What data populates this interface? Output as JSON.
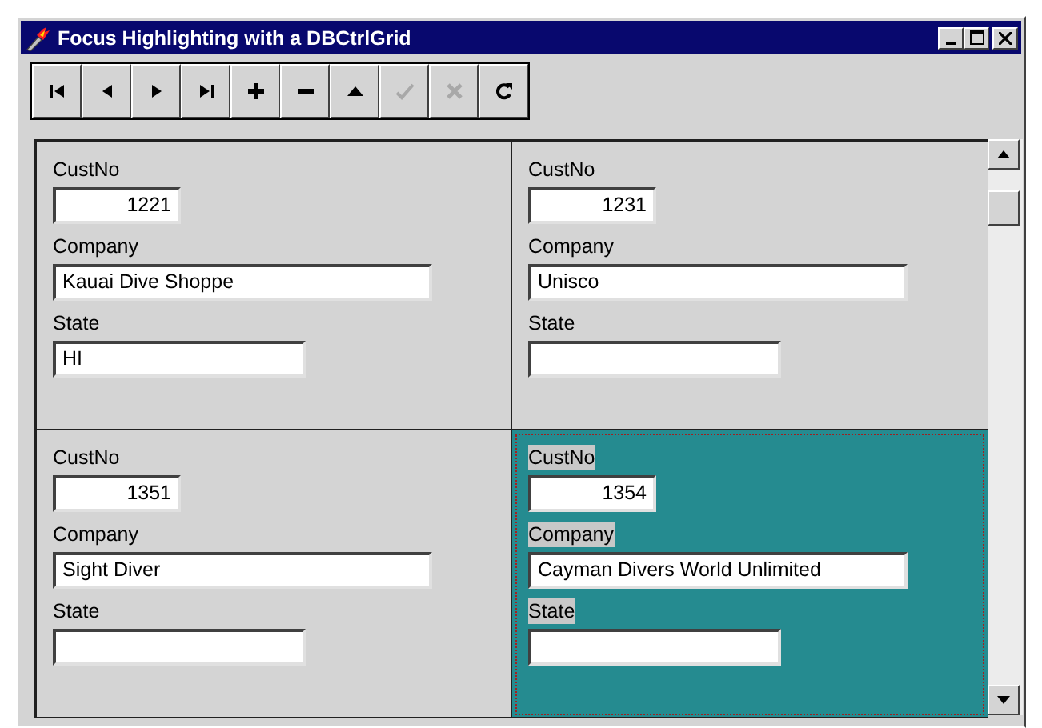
{
  "window": {
    "title": "Focus Highlighting with a DBCtrlGrid"
  },
  "navigator": [
    {
      "kind": "first",
      "disabled": false
    },
    {
      "kind": "prior",
      "disabled": false
    },
    {
      "kind": "next",
      "disabled": false
    },
    {
      "kind": "last",
      "disabled": false
    },
    {
      "kind": "insert",
      "disabled": false
    },
    {
      "kind": "delete",
      "disabled": false
    },
    {
      "kind": "edit",
      "disabled": false
    },
    {
      "kind": "post",
      "disabled": true
    },
    {
      "kind": "cancel",
      "disabled": true
    },
    {
      "kind": "refresh",
      "disabled": false
    }
  ],
  "records": [
    {
      "selected": false,
      "fields": [
        {
          "label": "CustNo",
          "value": "1221",
          "kind": "number"
        },
        {
          "label": "Company",
          "value": "Kauai Dive Shoppe",
          "kind": "wide"
        },
        {
          "label": "State",
          "value": "HI",
          "kind": "text"
        }
      ]
    },
    {
      "selected": false,
      "fields": [
        {
          "label": "CustNo",
          "value": "1231",
          "kind": "number"
        },
        {
          "label": "Company",
          "value": "Unisco",
          "kind": "wide"
        },
        {
          "label": "State",
          "kind": "text"
        }
      ]
    },
    {
      "selected": false,
      "fields": [
        {
          "label": "CustNo",
          "value": "1351",
          "kind": "number"
        },
        {
          "label": "Company",
          "value": "Sight Diver",
          "kind": "wide"
        },
        {
          "label": "State",
          "kind": "text"
        }
      ]
    },
    {
      "selected": true,
      "fields": [
        {
          "label": "CustNo",
          "value": "1354",
          "kind": "number"
        },
        {
          "label": "Company",
          "value": "Cayman Divers World Unlimited",
          "kind": "wide"
        },
        {
          "label": "State",
          "kind": "text"
        }
      ]
    }
  ]
}
